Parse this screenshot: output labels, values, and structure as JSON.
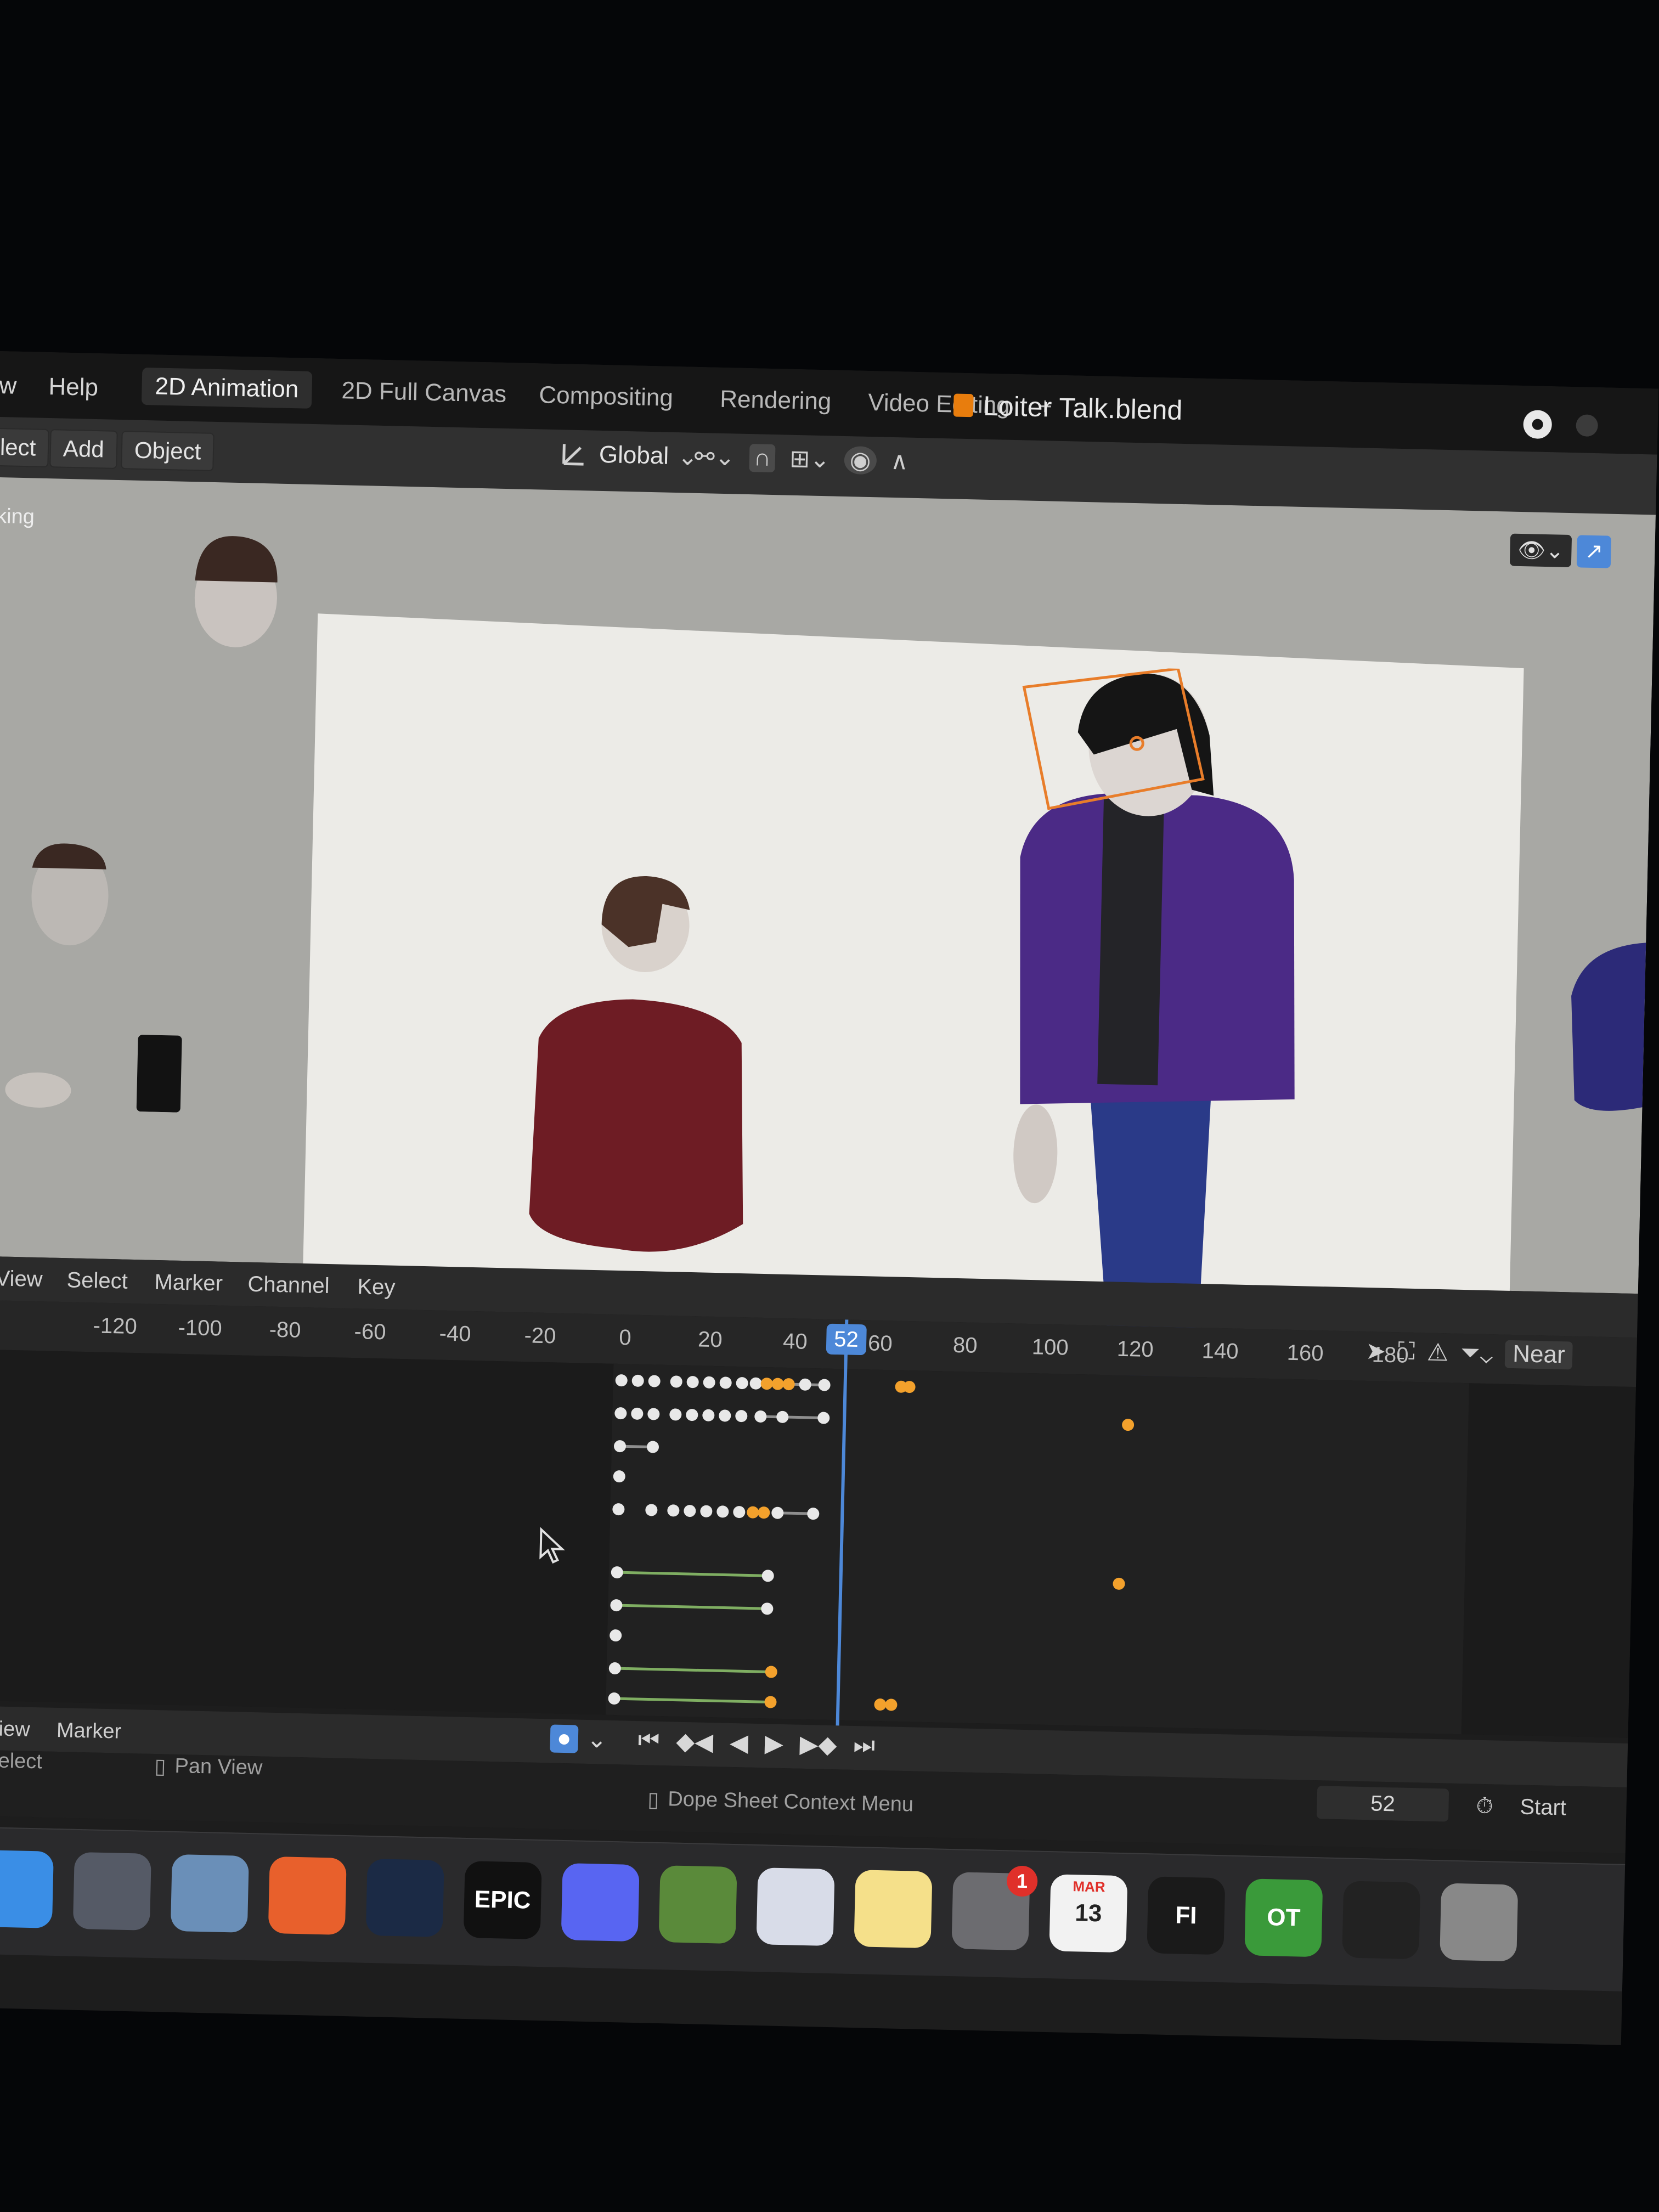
{
  "menus": [
    "w",
    "Help"
  ],
  "tabs": [
    {
      "label": "2D Animation",
      "active": true
    },
    {
      "label": "2D Full Canvas",
      "active": false
    },
    {
      "label": "Compositing",
      "active": false
    },
    {
      "label": "Rendering",
      "active": false
    },
    {
      "label": "Video Editing",
      "active": false
    },
    {
      "label": "+",
      "active": false
    }
  ],
  "file_title": "Loiter Talk.blend",
  "viewport_menu": [
    "lect",
    "Add",
    "Object"
  ],
  "transform_orientation": "Global",
  "viewport_side_label": "king",
  "dopesheet_menu": [
    "View",
    "Select",
    "Marker",
    "Channel",
    "Key"
  ],
  "ruler_ticks": [
    "-120",
    "-100",
    "-80",
    "-60",
    "-40",
    "-20",
    "0",
    "20",
    "40",
    "60",
    "80",
    "100",
    "120",
    "140",
    "160",
    "180"
  ],
  "current_frame_label": "52",
  "snap_label": "Near",
  "bottom_menu": [
    "View",
    "Marker"
  ],
  "status": {
    "select": "x Select",
    "pan": "Pan View",
    "context": "Dope Sheet Context Menu"
  },
  "playback": {
    "frame_field": "52",
    "start_label": "Start"
  },
  "dock_items": [
    {
      "name": "finder",
      "label": ""
    },
    {
      "name": "launchpad",
      "label": ""
    },
    {
      "name": "mail",
      "label": ""
    },
    {
      "name": "firefox",
      "label": ""
    },
    {
      "name": "steam",
      "label": ""
    },
    {
      "name": "epic-games",
      "label": "EPIC"
    },
    {
      "name": "discord",
      "label": ""
    },
    {
      "name": "minecraft",
      "label": ""
    },
    {
      "name": "app-blue",
      "label": ""
    },
    {
      "name": "notes",
      "label": ""
    },
    {
      "name": "system-preferences",
      "label": "",
      "badge": "1"
    },
    {
      "name": "calendar",
      "label": "13",
      "month": "MAR"
    },
    {
      "name": "fi-app",
      "label": "FI"
    },
    {
      "name": "ot-app",
      "label": "OT"
    },
    {
      "name": "final-cut",
      "label": ""
    },
    {
      "name": "dvd-player",
      "label": ""
    }
  ],
  "colors": {
    "accent": "#4d88d8",
    "keyframe_selected": "#f3a12c",
    "selection_outline": "#e87d2a",
    "jacket_purple": "#4b2a86",
    "shirt_red": "#6e1c24"
  }
}
